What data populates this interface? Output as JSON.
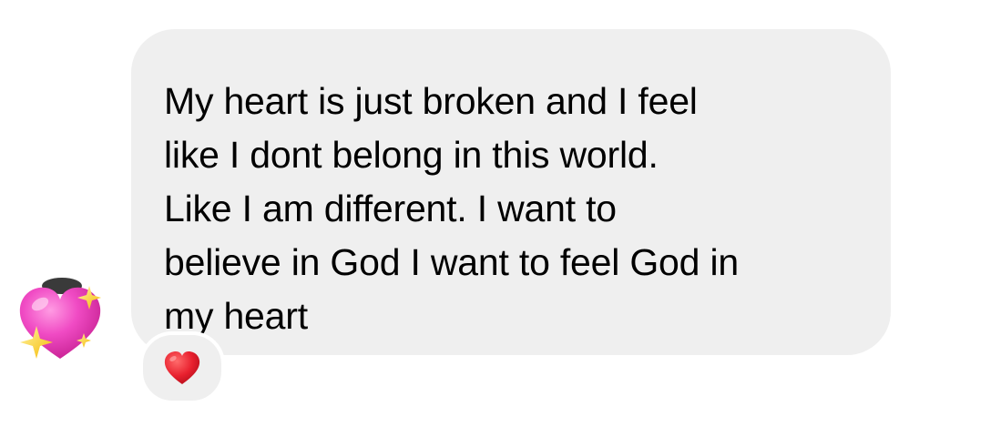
{
  "conversation": {
    "message": {
      "text": "My heart is just broken and I feel\nlike I dont belong in this world.\nLike I am different. I want to\nbelieve in God I want to feel God in\nmy heart",
      "bubble_color": "#efefef",
      "text_color": "#000000"
    },
    "sender_avatar": {
      "icon": "sparkling-heart-icon",
      "color": "#f04bc4"
    },
    "reaction": {
      "icon": "red-heart-icon",
      "color": "#e8202e"
    }
  }
}
